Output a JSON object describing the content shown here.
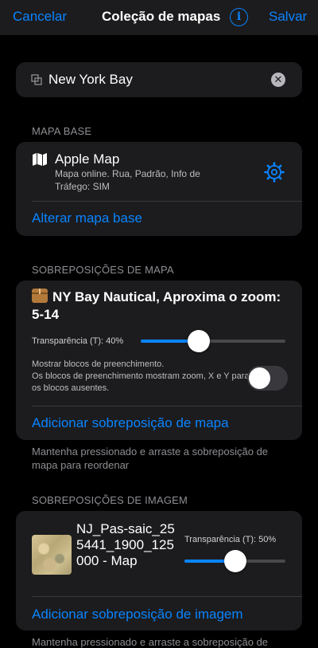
{
  "navbar": {
    "cancel_label": "Cancelar",
    "title": "Coleção de mapas",
    "save_label": "Salvar"
  },
  "name_field": {
    "value": "New York Bay"
  },
  "base_map": {
    "section_header": "MAPA BASE",
    "name": "Apple Map",
    "description": "Mapa online. Rua, Padrão, Info de Tráfego: SIM",
    "change_link": "Alterar mapa base"
  },
  "map_overlays": {
    "section_header": "SOBREPOSIÇÕES DE MAPA",
    "items": [
      {
        "title": "NY Bay Nautical, Aproxima o zoom: 5-14",
        "transparency_label": "Transparência (T): 40%",
        "transparency": 0.4,
        "fill_tiles_text": "Mostrar blocos de preenchimento.\nOs blocos de preenchimento mostram zoom, X e Y para os blocos ausentes.",
        "fill_tiles_enabled": false
      }
    ],
    "add_link": "Adicionar sobreposição de mapa",
    "footer": "Mantenha pressionado e arraste a sobreposição de mapa para reordenar"
  },
  "image_overlays": {
    "section_header": "SOBREPOSIÇÕES DE IMAGEM",
    "items": [
      {
        "name": "NJ_Pas-saic_255441_1900_125000 - Map",
        "transparency_label": "Transparência (T): 50%",
        "transparency": 0.5
      }
    ],
    "add_link": "Adicionar sobreposição de imagem",
    "footer": "Mantenha pressionado e arraste a sobreposição de"
  },
  "colors": {
    "accent": "#0a84ff",
    "background": "#000000",
    "card": "#1c1c1e",
    "secondary_text": "#8e8e93"
  }
}
